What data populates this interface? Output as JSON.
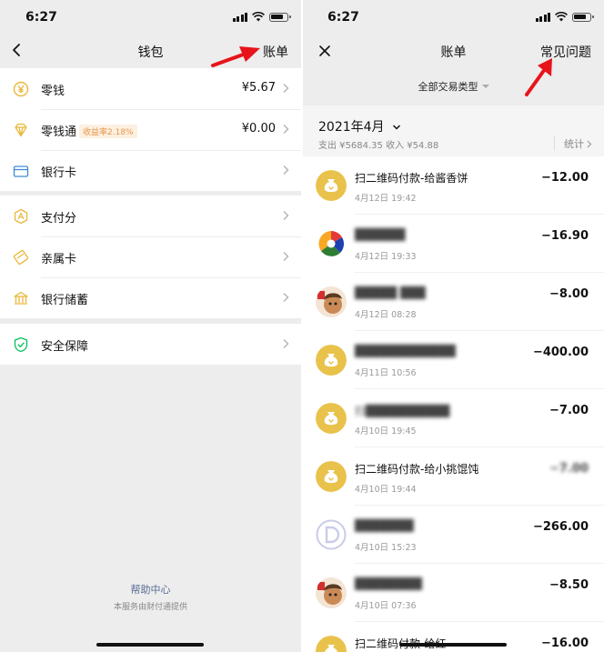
{
  "status": {
    "time": "6:27"
  },
  "wallet": {
    "title": "钱包",
    "action": "账单",
    "items": [
      {
        "label": "零钱",
        "value": "¥5.67",
        "icon": "yuan-coin-icon"
      },
      {
        "label": "零钱通",
        "badge": "收益率2.18%",
        "value": "¥0.00",
        "icon": "diamond-icon"
      },
      {
        "label": "银行卡",
        "icon": "bank-card-icon"
      },
      {
        "label": "支付分",
        "icon": "pay-score-icon"
      },
      {
        "label": "亲属卡",
        "icon": "family-card-icon"
      },
      {
        "label": "银行储蓄",
        "icon": "bank-savings-icon"
      },
      {
        "label": "安全保障",
        "icon": "shield-icon"
      }
    ],
    "help": "帮助中心",
    "provider": "本服务由财付通提供"
  },
  "bill": {
    "title": "账单",
    "action": "常见问题",
    "filter": "全部交易类型",
    "month": "2021年4月",
    "summary": "支出 ¥5684.35 收入 ¥54.88",
    "stats": "统计",
    "transactions": [
      {
        "title": "扫二维码付款-给酱香饼",
        "time": "4月12日 19:42",
        "amount": "−12.00",
        "icon": "money-bag-icon",
        "blurred": false
      },
      {
        "title": "██████",
        "time": "4月12日 19:33",
        "amount": "−16.90",
        "icon": "pinwheel-logo-icon",
        "blurred": true
      },
      {
        "title": "█████ ███",
        "time": "4月12日 08:28",
        "amount": "−8.00",
        "icon": "avatar-icon",
        "blurred": true
      },
      {
        "title": "████████████",
        "time": "4月11日 10:56",
        "amount": "−400.00",
        "icon": "money-bag-icon",
        "blurred": true
      },
      {
        "title": "扫██████████",
        "time": "4月10日 19:45",
        "amount": "−7.00",
        "icon": "money-bag-icon",
        "blurred": true
      },
      {
        "title": "扫二维码付款-给小挑馄饨",
        "time": "4月10日 19:44",
        "amount": "−7.00",
        "icon": "money-bag-icon",
        "blurred": false
      },
      {
        "title": "███████",
        "time": "4月10日 15:23",
        "amount": "−266.00",
        "icon": "d-logo-icon",
        "blurred": true
      },
      {
        "title": "████████",
        "time": "4月10日 07:36",
        "amount": "−8.50",
        "icon": "avatar-icon",
        "blurred": true
      },
      {
        "title": "扫二维码付款-给红",
        "time": "",
        "amount": "−16.00",
        "icon": "money-bag-icon",
        "blurred": false
      }
    ]
  },
  "colors": {
    "accent": "#07c160",
    "coin": "#e9c24b",
    "arrow": "#e8141b",
    "link": "#576b95"
  }
}
